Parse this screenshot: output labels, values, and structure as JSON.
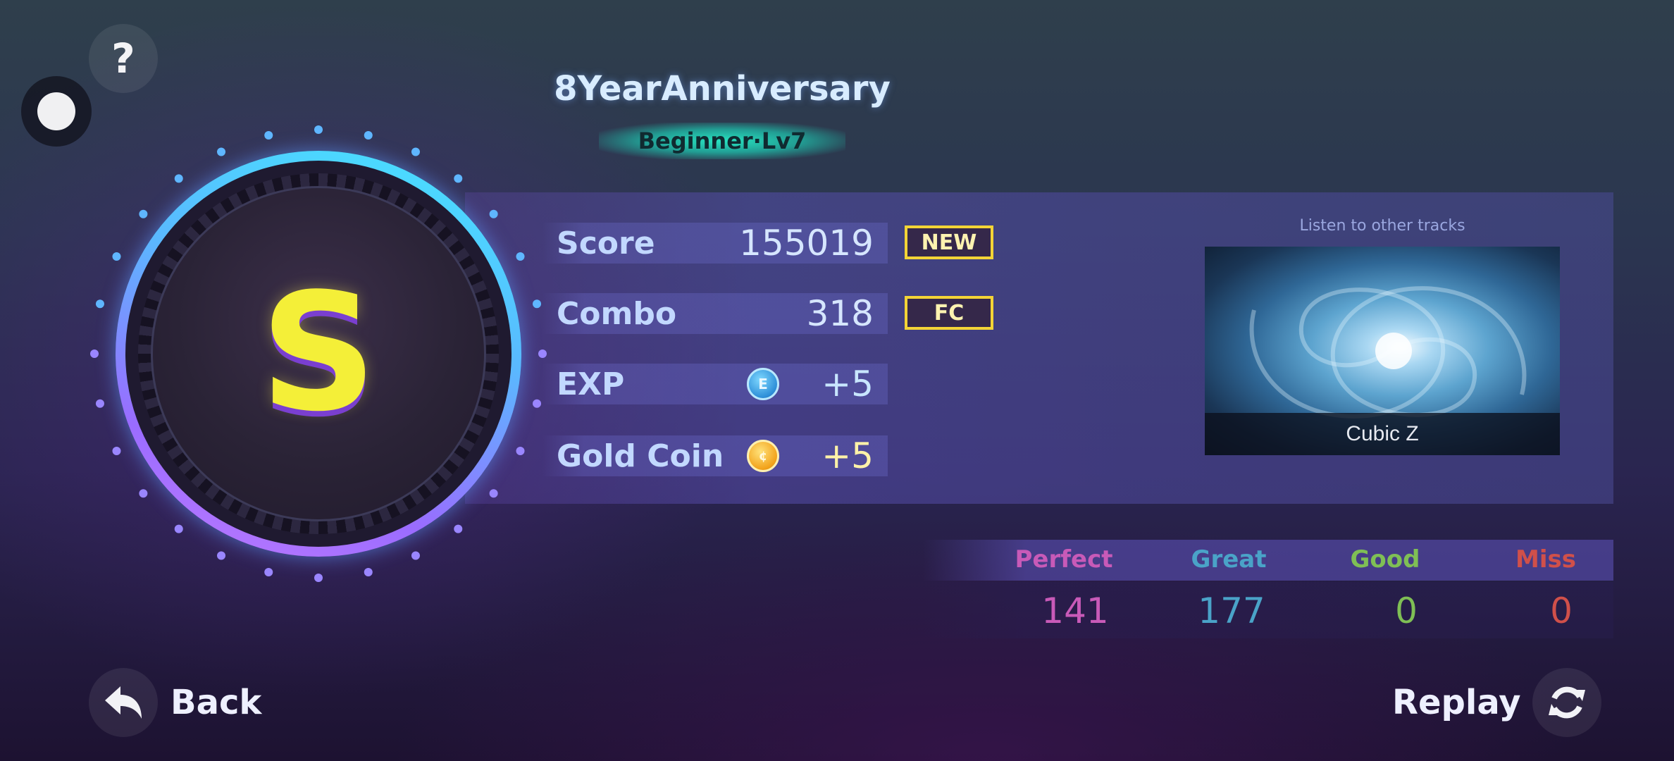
{
  "song": {
    "title": "8YearAnniversary",
    "difficulty": "Beginner·Lv7"
  },
  "rank": {
    "letter": "S"
  },
  "stats": {
    "score_label": "Score",
    "score_value": "155019",
    "score_badge": "NEW",
    "combo_label": "Combo",
    "combo_value": "318",
    "combo_badge": "FC",
    "exp_label": "EXP",
    "exp_icon_letter": "E",
    "exp_value": "+5",
    "gold_label": "Gold Coin",
    "gold_value": "+5"
  },
  "other_tracks": {
    "heading": "Listen to other tracks",
    "track_name": "Cubic Z"
  },
  "judgements": {
    "perfect_label": "Perfect",
    "perfect_value": "141",
    "great_label": "Great",
    "great_value": "177",
    "good_label": "Good",
    "good_value": "0",
    "miss_label": "Miss",
    "miss_value": "0"
  },
  "controls": {
    "help_icon": "question-icon",
    "back_label": "Back",
    "replay_label": "Replay"
  },
  "colors": {
    "perfect": "#c85ab8",
    "great": "#4aa3c8",
    "good": "#7fbf55",
    "miss": "#d0504a",
    "badge_border": "#f3d436",
    "rank_letter": "#f4ef38",
    "difficulty_bar": "#27e3c0"
  }
}
